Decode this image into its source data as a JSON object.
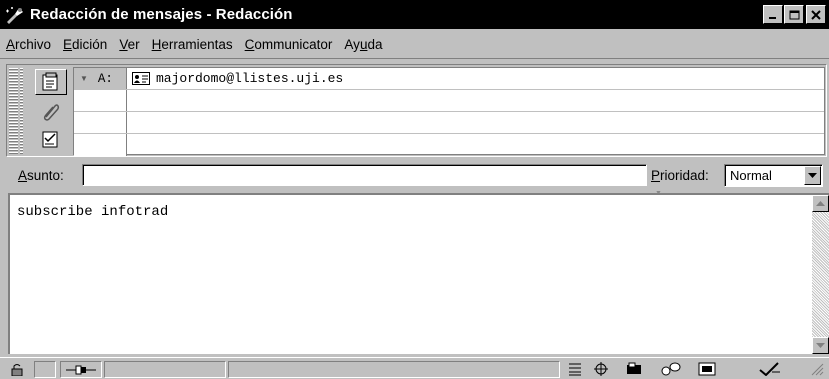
{
  "window": {
    "title": "Redacción de mensajes - Redacción",
    "minimize_glyph": "_",
    "maximize_glyph": "□",
    "close_glyph": "×"
  },
  "menu": {
    "items": [
      {
        "acc": "A",
        "rest": "rchivo"
      },
      {
        "acc": "E",
        "rest": "dición"
      },
      {
        "acc": "V",
        "rest": "er"
      },
      {
        "acc": "H",
        "rest": "erramientas"
      },
      {
        "acc": "C",
        "rest": "ommunicator"
      },
      {
        "pre": "Ay",
        "acc": "u",
        "rest": "da"
      }
    ]
  },
  "addressing": {
    "rows": [
      {
        "type": "A:",
        "value": "majordomo@llistes.uji.es"
      },
      {
        "type": "",
        "value": ""
      },
      {
        "type": "",
        "value": ""
      },
      {
        "type": "",
        "value": ""
      }
    ],
    "tabs": [
      "address-book-icon",
      "paperclip-icon",
      "options-icon"
    ]
  },
  "subject": {
    "label_acc": "A",
    "label_rest": "sunto:",
    "value": ""
  },
  "priority": {
    "label_acc": "P",
    "label_rest": "rioridad:",
    "value": "Normal"
  },
  "body": {
    "text": "subscribe infotrad"
  },
  "statusbar": {
    "icons": [
      "security-lock-icon",
      "connection-plug-icon",
      "component-bar-icon",
      "navigator-icon",
      "mail-icon",
      "discussion-icon",
      "composer-icon",
      "editor-icon"
    ]
  },
  "colors": {
    "titlebar_bg": "#000000",
    "face": "#c0c0c0",
    "window_bg": "#ffffff"
  }
}
